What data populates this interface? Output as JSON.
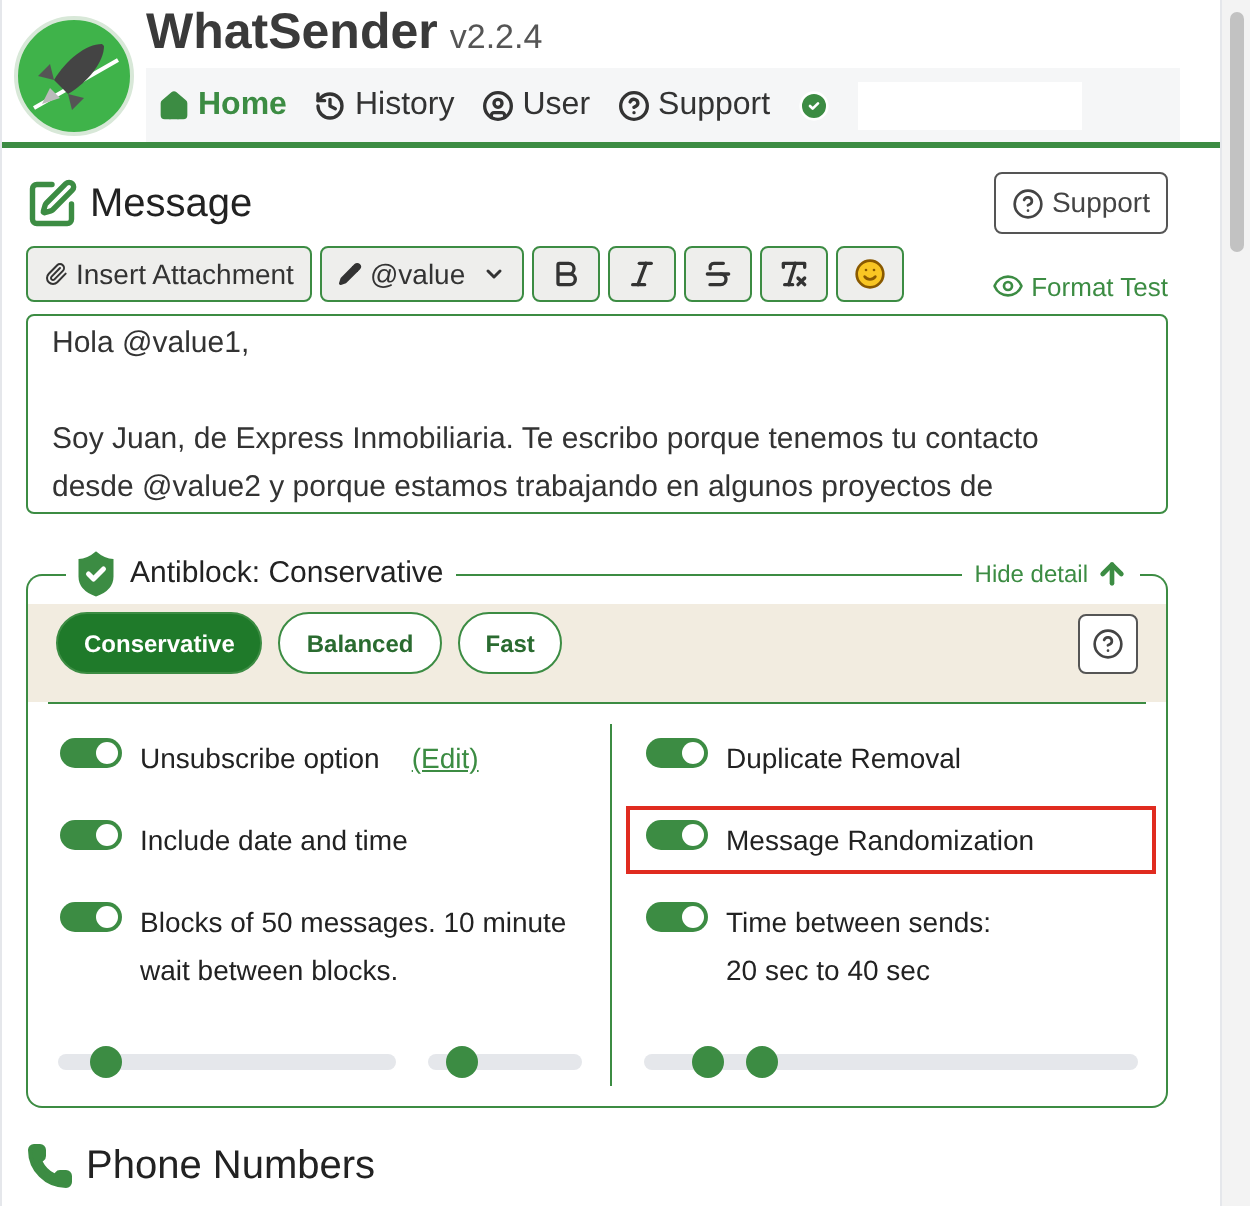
{
  "app": {
    "name": "WhatSender",
    "version": "v2.2.4"
  },
  "nav": [
    {
      "label": "Home",
      "selected": true
    },
    {
      "label": "History",
      "selected": false
    },
    {
      "label": "User",
      "selected": false
    },
    {
      "label": "Support",
      "selected": false
    }
  ],
  "message": {
    "title": "Message",
    "support_button": "Support",
    "toolbar": [
      {
        "kind": "attach",
        "label": "Insert Attachment"
      },
      {
        "kind": "value",
        "label": "@value"
      },
      {
        "kind": "bold"
      },
      {
        "kind": "italic"
      },
      {
        "kind": "strike"
      },
      {
        "kind": "clear"
      },
      {
        "kind": "emoji"
      }
    ],
    "format_test": "Format Test",
    "text": "Hola @value1,\n\nSoy Juan, de Express Inmobiliaria. Te escribo porque tenemos tu contacto desde @value2 y porque estamos trabajando en algunos proyectos de"
  },
  "antiblock": {
    "title": "Antiblock: Conservative",
    "hide_detail": "Hide detail",
    "modes": [
      {
        "label": "Conservative",
        "selected": true
      },
      {
        "label": "Balanced",
        "selected": false
      },
      {
        "label": "Fast",
        "selected": false
      }
    ],
    "left": [
      {
        "label": "Unsubscribe option",
        "link": "(Edit)",
        "on": true,
        "highlighted": false
      },
      {
        "label": "Include date and time",
        "on": true,
        "highlighted": false
      },
      {
        "label": "Blocks of 50 messages. 10 minute wait between blocks.",
        "on": true,
        "highlighted": false
      }
    ],
    "right": [
      {
        "label": "Duplicate Removal",
        "on": true,
        "highlighted": false
      },
      {
        "label": "Message Randomization",
        "on": true,
        "highlighted": true
      },
      {
        "label": "Time between sends:",
        "sub": "20 sec to 40 sec",
        "on": true,
        "highlighted": false
      }
    ],
    "left_sliders": [
      {
        "level": 0.14
      },
      {
        "level": 0.22
      }
    ],
    "range": [
      {
        "level": 0.13
      },
      {
        "level": 0.24
      }
    ]
  },
  "phone": {
    "title": "Phone Numbers"
  }
}
